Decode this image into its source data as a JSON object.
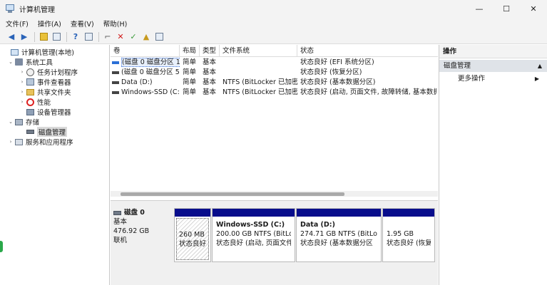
{
  "window": {
    "title": "计算机管理",
    "controls": {
      "minimize": "—",
      "maximize": "☐",
      "close": "✕"
    }
  },
  "menu": [
    "文件(F)",
    "操作(A)",
    "查看(V)",
    "帮助(H)"
  ],
  "toolbar": {
    "icons": [
      "back-arrow-icon",
      "forward-arrow-icon",
      "up-folder-icon",
      "show-hide-tree-icon",
      "help-icon",
      "properties-icon",
      "connect-icon",
      "delete-icon",
      "check-icon",
      "export-icon",
      "refresh-icon"
    ]
  },
  "tree": {
    "items": [
      {
        "label": "计算机管理(本地)",
        "icon": "computer-icon"
      },
      {
        "label": "系统工具",
        "icon": "tools-icon"
      },
      {
        "label": "任务计划程序",
        "icon": "clock-icon"
      },
      {
        "label": "事件查看器",
        "icon": "event-viewer-icon"
      },
      {
        "label": "共享文件夹",
        "icon": "folder-icon"
      },
      {
        "label": "性能",
        "icon": "performance-icon"
      },
      {
        "label": "设备管理器",
        "icon": "device-manager-icon"
      },
      {
        "label": "存储",
        "icon": "storage-icon"
      },
      {
        "label": "磁盘管理",
        "icon": "disk-icon"
      },
      {
        "label": "服务和应用程序",
        "icon": "services-icon"
      }
    ]
  },
  "volumes": {
    "columns": [
      "卷",
      "布局",
      "类型",
      "文件系统",
      "状态"
    ],
    "rows": [
      {
        "volume": "(磁盘 0 磁盘分区 1)",
        "layout": "简单",
        "type": "基本",
        "fs": "",
        "status": "状态良好 (EFI 系统分区)"
      },
      {
        "volume": "(磁盘 0 磁盘分区 5)",
        "layout": "简单",
        "type": "基本",
        "fs": "",
        "status": "状态良好 (恢复分区)"
      },
      {
        "volume": "Data (D:)",
        "layout": "简单",
        "type": "基本",
        "fs": "NTFS (BitLocker 已加密)",
        "status": "状态良好 (基本数据分区)"
      },
      {
        "volume": "Windows-SSD (C:)",
        "layout": "简单",
        "type": "基本",
        "fs": "NTFS (BitLocker 已加密)",
        "status": "状态良好 (启动, 页面文件, 故障转储, 基本数据分"
      }
    ]
  },
  "disk": {
    "name": "磁盘 0",
    "type": "基本",
    "size": "476.92 GB",
    "status": "联机",
    "partitions": [
      {
        "name": "",
        "size": "260 MB",
        "status": "状态良好 ("
      },
      {
        "name": "Windows-SSD  (C:)",
        "size": "200.00 GB NTFS (BitLock",
        "status": "状态良好 (启动, 页面文件,"
      },
      {
        "name": "Data  (D:)",
        "size": "274.71 GB NTFS (BitLocke",
        "status": "状态良好 (基本数据分区"
      },
      {
        "name": "",
        "size": "1.95 GB",
        "status": "状态良好 (恢复分"
      }
    ]
  },
  "actions": {
    "header": "操作",
    "section": "磁盘管理",
    "more": "更多操作"
  },
  "colors": {
    "partition_bar": "#080d8c",
    "selection": "#3a6fd8"
  }
}
